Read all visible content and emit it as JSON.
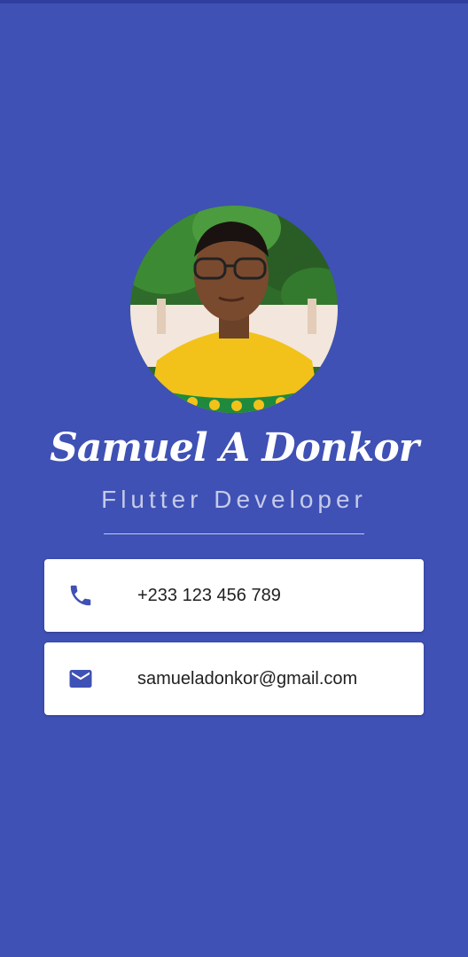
{
  "profile": {
    "name": "Samuel A Donkor",
    "role": "Flutter Developer",
    "avatar_icon": "profile-photo"
  },
  "contacts": {
    "phone": {
      "icon": "phone-icon",
      "value": "+233 123 456 789"
    },
    "email": {
      "icon": "mail-icon",
      "value": "samueladonkor@gmail.com"
    }
  },
  "colors": {
    "background": "#3f51b5",
    "accent_text": "#c5cae9",
    "card": "#ffffff",
    "icon": "#3f51b5"
  }
}
